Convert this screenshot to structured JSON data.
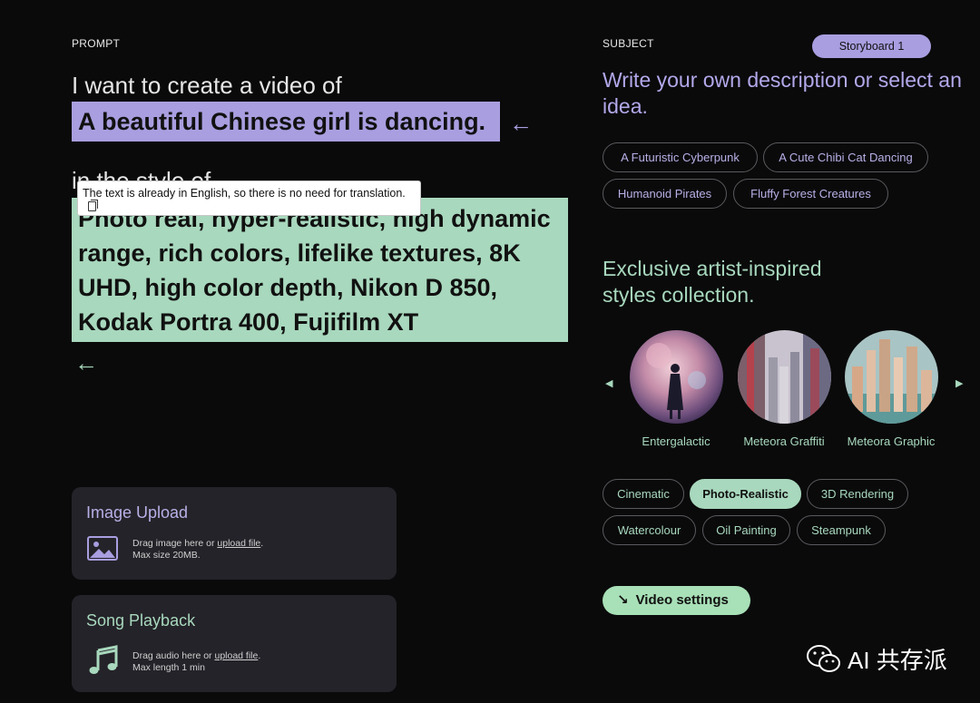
{
  "prompt": {
    "label": "PROMPT",
    "intro": "I want to create a video of",
    "subject": "A beautiful Chinese girl is dancing.",
    "style_intro": "in the style of",
    "style_text": "Photo real, hyper-realistic, high dynamic range, rich colors, lifelike textures, 8K UHD, high color depth, Nikon D 850, Kodak Portra 400, Fujifilm XT",
    "tooltip": "The text is already in English, so there is no need for translation."
  },
  "uploads": {
    "image": {
      "title": "Image Upload",
      "line1_prefix": "Drag image here or ",
      "link": "upload file",
      "line1_suffix": ".",
      "line2": "Max size 20MB."
    },
    "song": {
      "title": "Song Playback",
      "line1_prefix": "Drag audio here or ",
      "link": "upload file",
      "line1_suffix": ".",
      "line2": "Max length 1 min"
    }
  },
  "subject": {
    "label": "SUBJECT",
    "storyboard": "Storyboard 1",
    "heading": "Write your own description or select an idea.",
    "ideas": [
      "A Futuristic Cyberpunk",
      "A Cute Chibi Cat Dancing",
      "Humanoid Pirates",
      "Fluffy Forest Creatures"
    ]
  },
  "artists": {
    "heading_line1": "Exclusive artist-inspired",
    "heading_line2": "styles collection.",
    "items": [
      "Entergalactic",
      "Meteora Graffiti",
      "Meteora Graphic"
    ]
  },
  "styles": {
    "items": [
      "Cinematic",
      "Photo-Realistic",
      "3D Rendering",
      "Watercolour",
      "Oil Painting",
      "Steampunk"
    ],
    "active": "Photo-Realistic"
  },
  "video_settings": "Video settings",
  "watermark": "AI 共存派",
  "colors": {
    "background": "#0a0a0b",
    "purple_accent": "#a99ee0",
    "green_accent": "#a8d8bd",
    "card": "#242329"
  }
}
